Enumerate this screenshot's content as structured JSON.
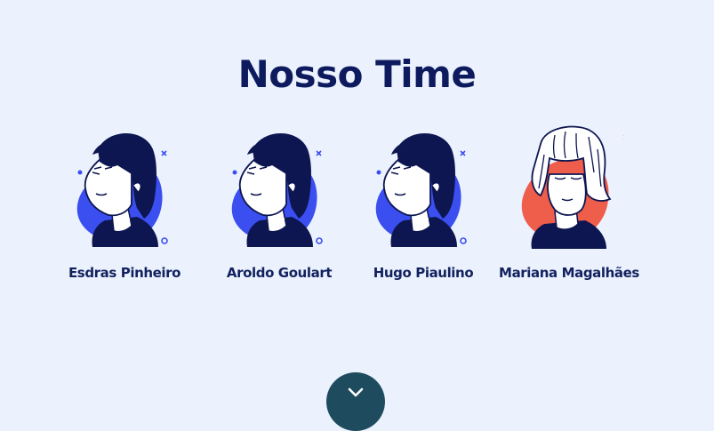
{
  "section": {
    "title": "Nosso Time"
  },
  "team": [
    {
      "name": "Esdras Pinheiro",
      "avatar": "man-avatar-illustration",
      "accent": "#3b4ef0"
    },
    {
      "name": "Aroldo Goulart",
      "avatar": "man-avatar-illustration",
      "accent": "#3b4ef0"
    },
    {
      "name": "Hugo Piaulino",
      "avatar": "man-avatar-illustration",
      "accent": "#3b4ef0"
    },
    {
      "name": "Mariana Magalhães",
      "avatar": "woman-avatar-illustration",
      "accent": "#ef5d4b"
    }
  ],
  "scroll_button": {
    "icon": "chevron-down-icon",
    "color": "#1f4b5f"
  },
  "colors": {
    "background": "#ebf2fe",
    "title": "#0d1b5e",
    "ink": "#0d1650"
  }
}
